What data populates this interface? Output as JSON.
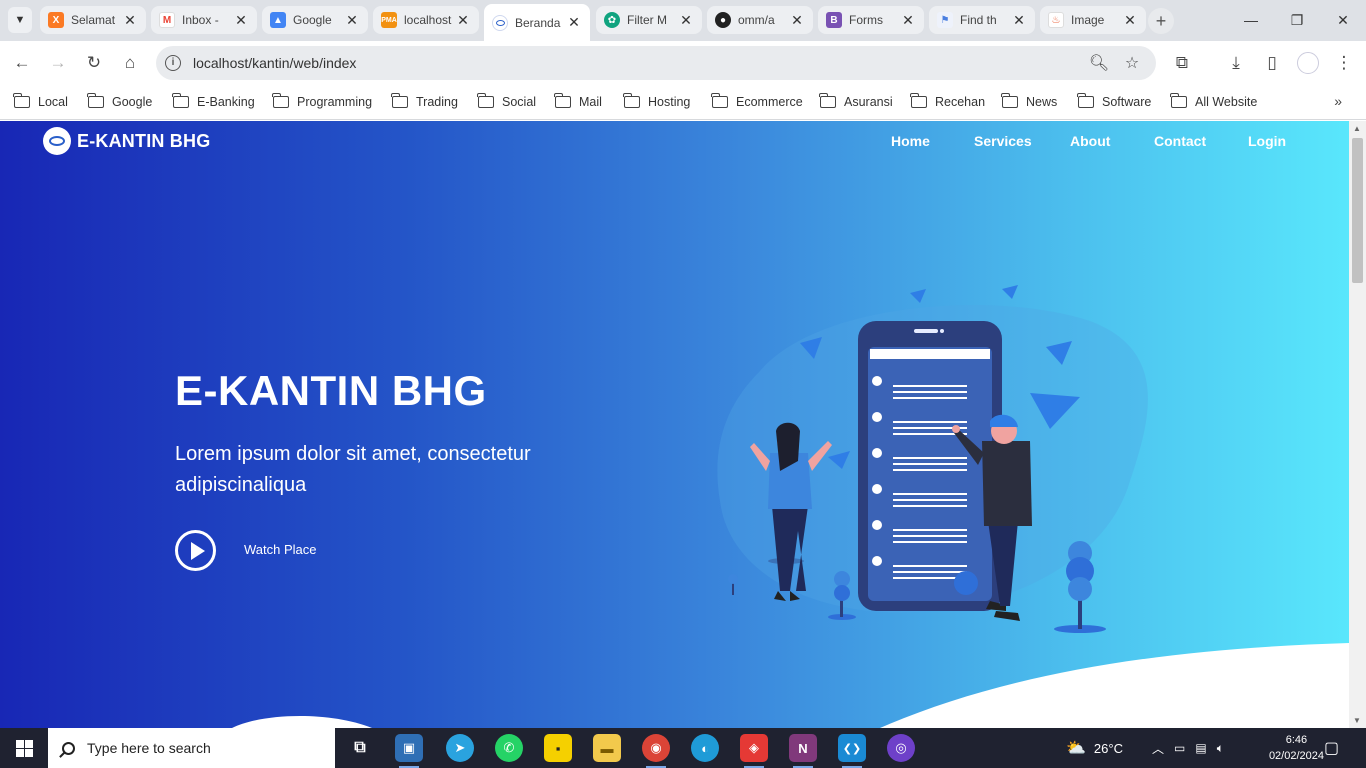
{
  "browser": {
    "tabs": [
      {
        "title": "Selamat",
        "icon": "xampp-icon",
        "color": "#fb7a24"
      },
      {
        "title": "Inbox -",
        "icon": "gmail-icon",
        "color": "#ea4335"
      },
      {
        "title": "Google",
        "icon": "google-ads-icon",
        "color": "#4285f4"
      },
      {
        "title": "localhost",
        "icon": "phpmyadmin-icon",
        "color": "#f29111"
      },
      {
        "title": "Beranda",
        "icon": "site-logo-icon",
        "color": "#2a5fc9"
      },
      {
        "title": "Filter M",
        "icon": "chatgpt-icon",
        "color": "#10a37f"
      },
      {
        "title": "omm/a",
        "icon": "github-icon",
        "color": "#222222"
      },
      {
        "title": "Forms",
        "icon": "bootstrap-icon",
        "color": "#7952b3"
      },
      {
        "title": "Find th",
        "icon": "flag-icon",
        "color": "#4a7fe0"
      },
      {
        "title": "Image",
        "icon": "fire-icon",
        "color": "#e8542a"
      }
    ],
    "active_tab": "Beranda",
    "url": "localhost/kantin/web/index",
    "bookmarks": [
      "Local",
      "Google",
      "E-Banking",
      "Programming",
      "Trading",
      "Social",
      "Mail",
      "Hosting",
      "Ecommerce",
      "Asuransi",
      "Recehan",
      "News",
      "Software",
      "All Website"
    ]
  },
  "site": {
    "brand": "E-KANTIN BHG",
    "nav": [
      "Home",
      "Services",
      "About",
      "Contact",
      "Login"
    ],
    "hero_title": "E-KANTIN BHG",
    "hero_subtitle": "Lorem ipsum dolor sit amet, consectetur adipiscinaliqua",
    "watch_label": "Watch Place",
    "gradient": [
      "#1827b5",
      "#59e7fc"
    ]
  },
  "taskbar": {
    "search_placeholder": "Type here to search",
    "weather": "26°C",
    "time": "6:46",
    "date": "02/02/2024",
    "apps": [
      {
        "name": "task-view",
        "color": "#1f2230",
        "glyph": "⧉"
      },
      {
        "name": "virtualbox",
        "color": "#2f6fb5",
        "glyph": "▣"
      },
      {
        "name": "telegram",
        "color": "#2aa3df",
        "glyph": "➤"
      },
      {
        "name": "whatsapp",
        "color": "#25d366",
        "glyph": "✆"
      },
      {
        "name": "sticky-notes",
        "color": "#f5d000",
        "glyph": "▪"
      },
      {
        "name": "file-explorer",
        "color": "#f2c94c",
        "glyph": "▬"
      },
      {
        "name": "chrome",
        "color": "#db4437",
        "glyph": "◉"
      },
      {
        "name": "edge",
        "color": "#1f9bd7",
        "glyph": "◐"
      },
      {
        "name": "anydesk",
        "color": "#e53935",
        "glyph": "◈"
      },
      {
        "name": "onenote",
        "color": "#80397b",
        "glyph": "N"
      },
      {
        "name": "vscode",
        "color": "#1a8ad4",
        "glyph": "❮❯"
      },
      {
        "name": "github-desktop",
        "color": "#6e40c9",
        "glyph": "◎"
      }
    ]
  }
}
